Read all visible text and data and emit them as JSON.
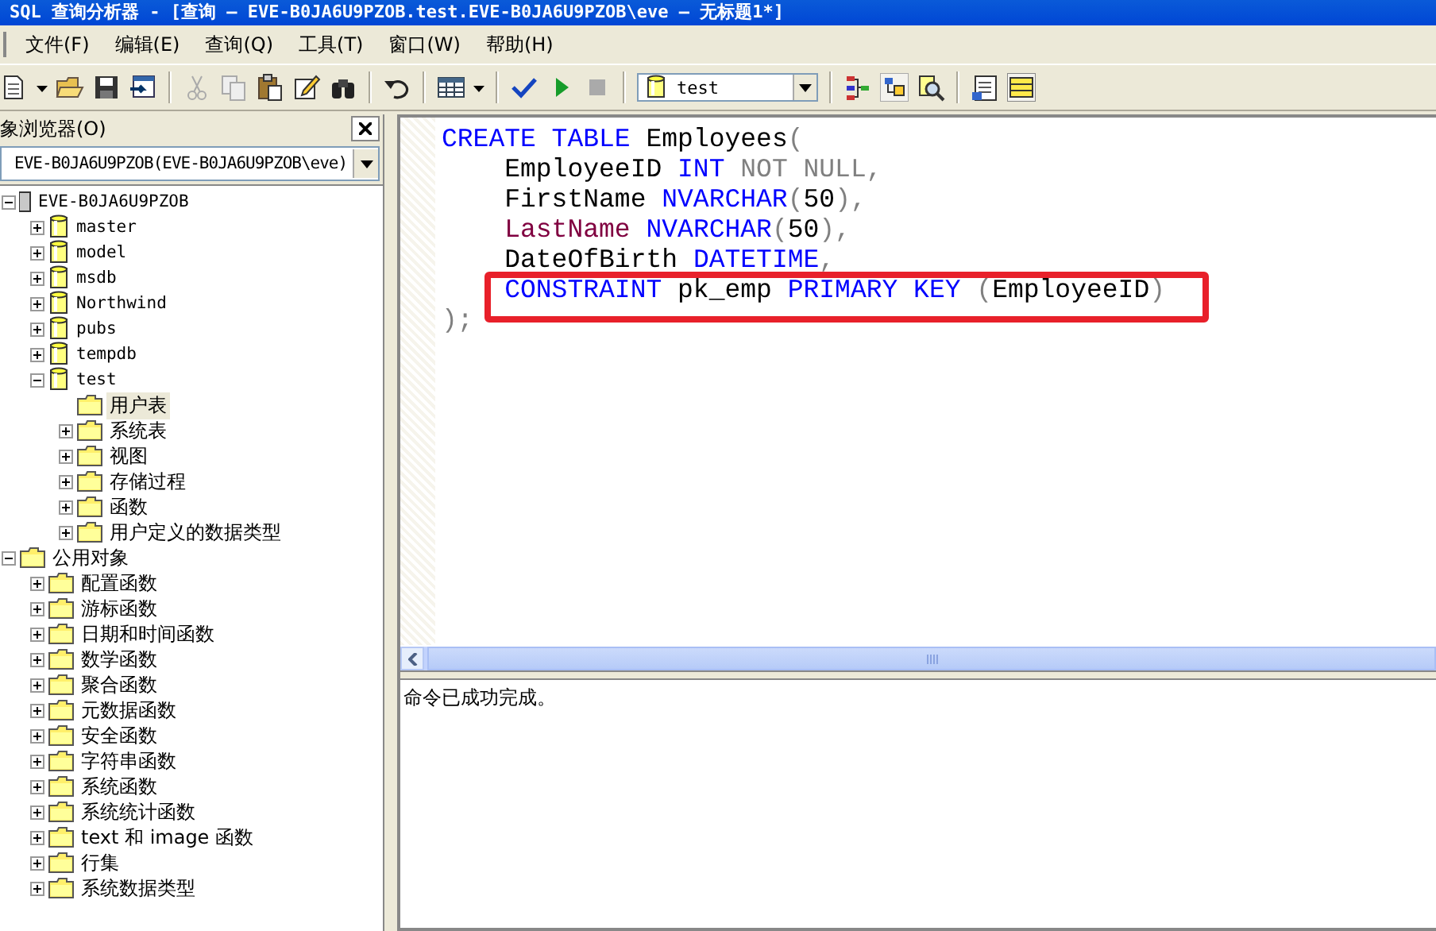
{
  "window": {
    "title": "SQL 查询分析器 - [查询 — EVE-B0JA6U9PZOB.test.EVE-B0JA6U9PZOB\\eve — 无标题1*]"
  },
  "menu": [
    "文件(F)",
    "编辑(E)",
    "查询(Q)",
    "工具(T)",
    "窗口(W)",
    "帮助(H)"
  ],
  "toolbar": {
    "database": "test"
  },
  "object_browser": {
    "title": "象浏览器(O)",
    "server": "EVE-B0JA6U9PZOB(EVE-B0JA6U9PZOB\\eve)",
    "tree": [
      {
        "label": "EVE-B0JA6U9PZOB",
        "kind": "server",
        "expanded": true,
        "selected": false,
        "children": [
          {
            "label": "master",
            "kind": "database",
            "expanded": false,
            "selected": false
          },
          {
            "label": "model",
            "kind": "database",
            "expanded": false,
            "selected": false
          },
          {
            "label": "msdb",
            "kind": "database",
            "expanded": false,
            "selected": false
          },
          {
            "label": "Northwind",
            "kind": "database",
            "expanded": false,
            "selected": false
          },
          {
            "label": "pubs",
            "kind": "database",
            "expanded": false,
            "selected": false
          },
          {
            "label": "tempdb",
            "kind": "database",
            "expanded": false,
            "selected": false
          },
          {
            "label": "test",
            "kind": "database",
            "expanded": true,
            "selected": false,
            "children": [
              {
                "label": "用户表",
                "kind": "folder",
                "selected": true
              },
              {
                "label": "系统表",
                "kind": "folder",
                "expanded": false,
                "selected": false
              },
              {
                "label": "视图",
                "kind": "folder",
                "expanded": false,
                "selected": false
              },
              {
                "label": "存储过程",
                "kind": "folder",
                "expanded": false,
                "selected": false
              },
              {
                "label": "函数",
                "kind": "folder",
                "expanded": false,
                "selected": false
              },
              {
                "label": "用户定义的数据类型",
                "kind": "folder",
                "expanded": false,
                "selected": false
              }
            ]
          }
        ]
      },
      {
        "label": "公用对象",
        "kind": "folder",
        "expanded": true,
        "selected": false,
        "children": [
          {
            "label": "配置函数",
            "kind": "folder",
            "expanded": false,
            "selected": false
          },
          {
            "label": "游标函数",
            "kind": "folder",
            "expanded": false,
            "selected": false
          },
          {
            "label": "日期和时间函数",
            "kind": "folder",
            "expanded": false,
            "selected": false
          },
          {
            "label": "数学函数",
            "kind": "folder",
            "expanded": false,
            "selected": false
          },
          {
            "label": "聚合函数",
            "kind": "folder",
            "expanded": false,
            "selected": false
          },
          {
            "label": "元数据函数",
            "kind": "folder",
            "expanded": false,
            "selected": false
          },
          {
            "label": "安全函数",
            "kind": "folder",
            "expanded": false,
            "selected": false
          },
          {
            "label": "字符串函数",
            "kind": "folder",
            "expanded": false,
            "selected": false
          },
          {
            "label": "系统函数",
            "kind": "folder",
            "expanded": false,
            "selected": false
          },
          {
            "label": "系统统计函数",
            "kind": "folder",
            "expanded": false,
            "selected": false
          },
          {
            "label": "text 和 image 函数",
            "kind": "folder",
            "expanded": false,
            "selected": false
          },
          {
            "label": "行集",
            "kind": "folder",
            "expanded": false,
            "selected": false
          },
          {
            "label": "系统数据类型",
            "kind": "folder",
            "expanded": false,
            "selected": false
          }
        ]
      }
    ]
  },
  "editor": {
    "lines": [
      {
        "highlighted": false,
        "tokens": [
          {
            "text": "CREATE TABLE ",
            "kind": "keyword"
          },
          {
            "text": "Employees",
            "kind": "plain"
          },
          {
            "text": "(",
            "kind": "gray"
          }
        ]
      },
      {
        "highlighted": false,
        "tokens": [
          {
            "text": "    EmployeeID ",
            "kind": "plain"
          },
          {
            "text": "INT ",
            "kind": "keyword"
          },
          {
            "text": "NOT NULL,",
            "kind": "gray"
          }
        ]
      },
      {
        "highlighted": false,
        "tokens": [
          {
            "text": "    FirstName ",
            "kind": "plain"
          },
          {
            "text": "NVARCHAR",
            "kind": "keyword"
          },
          {
            "text": "(",
            "kind": "gray"
          },
          {
            "text": "50",
            "kind": "plain"
          },
          {
            "text": "),",
            "kind": "gray"
          }
        ]
      },
      {
        "highlighted": false,
        "tokens": [
          {
            "text": "    LastName ",
            "kind": "system"
          },
          {
            "text": "NVARCHAR",
            "kind": "keyword"
          },
          {
            "text": "(",
            "kind": "gray"
          },
          {
            "text": "50",
            "kind": "plain"
          },
          {
            "text": "),",
            "kind": "gray"
          }
        ]
      },
      {
        "highlighted": false,
        "tokens": [
          {
            "text": "    DateOfBirth ",
            "kind": "plain"
          },
          {
            "text": "DATETIME",
            "kind": "keyword"
          },
          {
            "text": ",",
            "kind": "gray"
          }
        ]
      },
      {
        "highlighted": true,
        "tokens": [
          {
            "text": "    CONSTRAINT ",
            "kind": "keyword"
          },
          {
            "text": "pk_emp ",
            "kind": "plain"
          },
          {
            "text": "PRIMARY KEY ",
            "kind": "keyword"
          },
          {
            "text": "(",
            "kind": "gray"
          },
          {
            "text": "EmployeeID",
            "kind": "plain"
          },
          {
            "text": ")",
            "kind": "gray"
          }
        ]
      },
      {
        "highlighted": false,
        "tokens": [
          {
            "text": ");",
            "kind": "gray"
          }
        ]
      }
    ]
  },
  "results": {
    "message": "命令已成功完成。"
  }
}
